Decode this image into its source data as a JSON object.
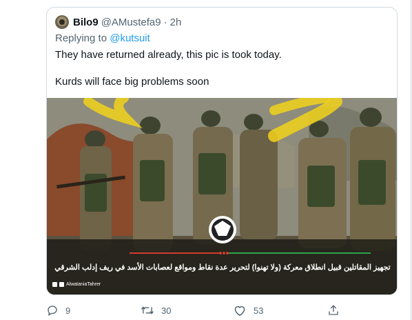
{
  "quoted_tweet": {
    "display_name": "Bilo9",
    "handle": "@AMustefa9",
    "separator": "·",
    "time": "2h",
    "reply_prefix": "Replying to ",
    "reply_to": "@kutsuit",
    "text_line1": "They have returned already, this pic is took today.",
    "text_line2": "Kurds will face big problems soon",
    "media": {
      "caption": "تجهيز المقاتلين قبيل انطلاق معركة (ولا تهنوا) لتحرير عدة نقاط ومواقع لعصابات الأسد في ريف إدلب الشرقي",
      "watermark": "AlwataniaTahrer"
    }
  },
  "actions": {
    "replies": "9",
    "retweets": "30",
    "likes": "53"
  },
  "colors": {
    "accent": "#1d9bf0",
    "muted": "#536471",
    "border": "#cfd9de",
    "highlight": "#f2d21a"
  }
}
